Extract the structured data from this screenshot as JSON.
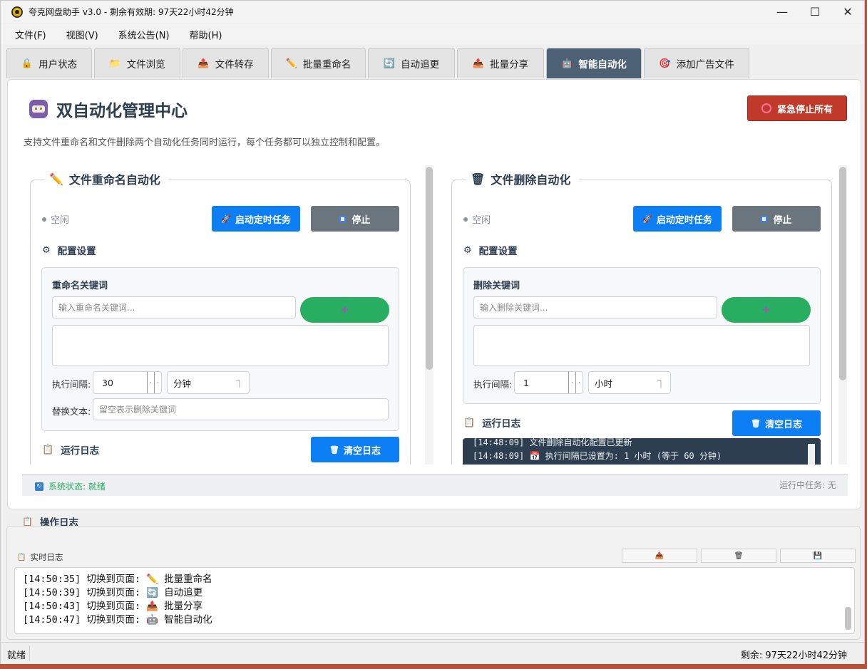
{
  "window": {
    "title": "夸克网盘助手 v3.0 - 剩余有效期: 97天22小时42分钟",
    "minimize": "—",
    "maximize": "☐",
    "close": "✕"
  },
  "menu": [
    "文件(F)",
    "视图(V)",
    "系统公告(N)",
    "帮助(H)"
  ],
  "tabs": [
    {
      "label": "用户状态",
      "icon": "🔒"
    },
    {
      "label": "文件浏览",
      "icon": "📁"
    },
    {
      "label": "文件转存",
      "icon": "📤"
    },
    {
      "label": "批量重命名",
      "icon": "✏️"
    },
    {
      "label": "自动追更",
      "icon": "🔄"
    },
    {
      "label": "批量分享",
      "icon": "📤"
    },
    {
      "label": "智能自动化",
      "icon": "🤖",
      "active": true
    },
    {
      "label": "添加广告文件",
      "icon": "🎯"
    }
  ],
  "panel": {
    "title": "双自动化管理中心",
    "emergency_stop": "紧急停止所有",
    "subtitle": "支持文件重命名和文件删除两个自动化任务同时运行，每个任务都可以独立控制和配置。"
  },
  "rename": {
    "title": "文件重命名自动化",
    "icon": "✏️",
    "status": "空闲",
    "start_btn": "启动定时任务",
    "stop_btn": "停止",
    "config_title": "配置设置",
    "keyword_label": "重命名关键词",
    "keyword_placeholder": "输入重命名关键词...",
    "add_btn": "✚",
    "interval_label": "执行间隔:",
    "interval_value": "30",
    "interval_unit": "分钟",
    "replace_label": "替换文本:",
    "replace_placeholder": "留空表示删除关键词",
    "log_title": "运行日志",
    "clear_btn": "清空日志"
  },
  "delete": {
    "title": "文件删除自动化",
    "icon": "🗑",
    "status": "空闲",
    "start_btn": "启动定时任务",
    "stop_btn": "停止",
    "config_title": "配置设置",
    "keyword_label": "删除关键词",
    "keyword_placeholder": "输入删除关键词...",
    "add_btn": "✚",
    "interval_label": "执行间隔:",
    "interval_value": "1",
    "interval_unit": "小时",
    "log_title": "运行日志",
    "clear_btn": "清空日志",
    "log_lines": [
      "[14:48:09] 文件删除自动化配置已更新",
      "[14:48:09] 📅 执行间隔已设置为: 1 小时 (等于 60 分钟)"
    ]
  },
  "status_line": {
    "system": "系统状态: 就绪",
    "running": "运行中任务: 无"
  },
  "op_log": {
    "title": "操作日志",
    "realtime_label": "实时日志",
    "tools": [
      "📤",
      "🗑",
      "💾"
    ],
    "lines": [
      "[14:50:35] 切换到页面: ✏️ 批量重命名",
      "[14:50:39] 切换到页面: 🔄 自动追更",
      "[14:50:43] 切换到页面: 📤 批量分享",
      "[14:50:47] 切换到页面: 🤖 智能自动化"
    ]
  },
  "statusbar": {
    "left": "就绪",
    "right": "剩余: 97天22小时42分钟"
  }
}
